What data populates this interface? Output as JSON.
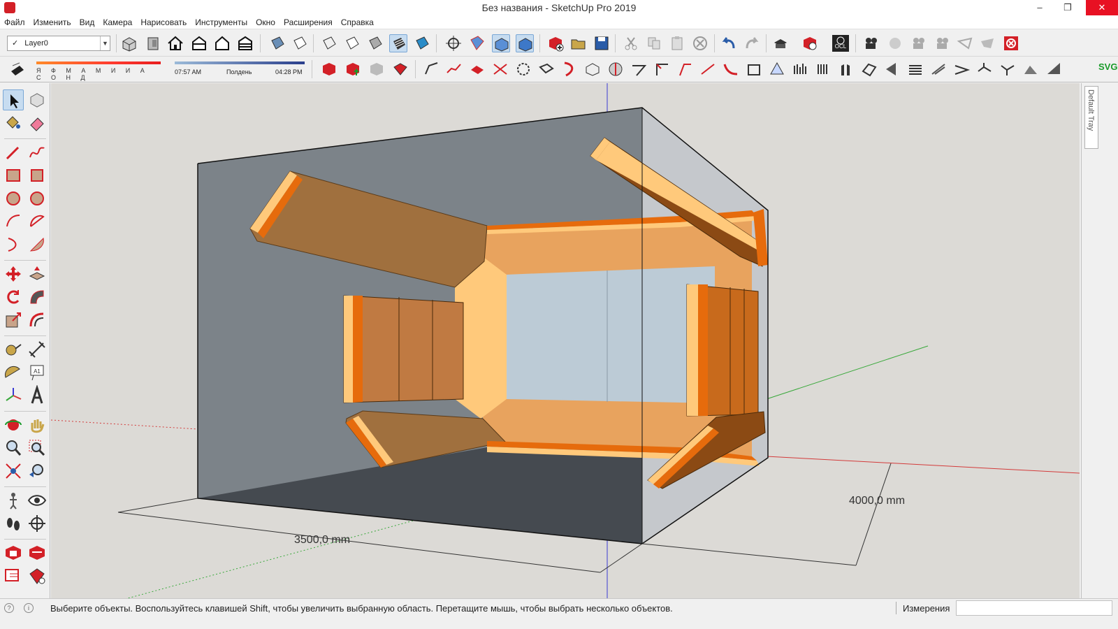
{
  "window": {
    "title": "Без названия - SketchUp Pro 2019",
    "minimize": "–",
    "maximize": "❐",
    "close": "✕"
  },
  "menu": [
    "Файл",
    "Изменить",
    "Вид",
    "Камера",
    "Нарисовать",
    "Инструменты",
    "Окно",
    "Расширения",
    "Справка"
  ],
  "layer": {
    "check": "✓",
    "name": "Layer0",
    "dropdown": "▼"
  },
  "shadows": {
    "months": "Я Ф М А М И И А С О Н Д",
    "time_start": "07:57 AM",
    "time_mid": "Полдень",
    "time_end": "04:28 PM"
  },
  "toolbar_right_label": "SVG",
  "ocl_label": "OCL",
  "text_tool_label": "A1",
  "tray": {
    "label": "Default Tray"
  },
  "dimensions": {
    "width_text": "3500,0 mm",
    "depth_text": "4000,0 mm"
  },
  "status": {
    "info1": "?",
    "info2": "i",
    "message": "Выберите объекты. Воспользуйтесь клавишей Shift, чтобы увеличить выбранную область. Перетащите мышь, чтобы выбрать несколько объектов.",
    "measurements_label": "Измерения",
    "measurements_value": ""
  },
  "colors": {
    "red_axis": "#d33a3a",
    "green_axis": "#38a83a",
    "blue_axis": "#3a3ad3",
    "panel_dark": "#a0703e",
    "panel_mid": "#e8a35e",
    "panel_light": "#ffc97b",
    "panel_edge": "#e66b0c",
    "wall_grey": "#7c8389",
    "floor_dark": "#454a50",
    "window_blue": "#bccbd6"
  }
}
